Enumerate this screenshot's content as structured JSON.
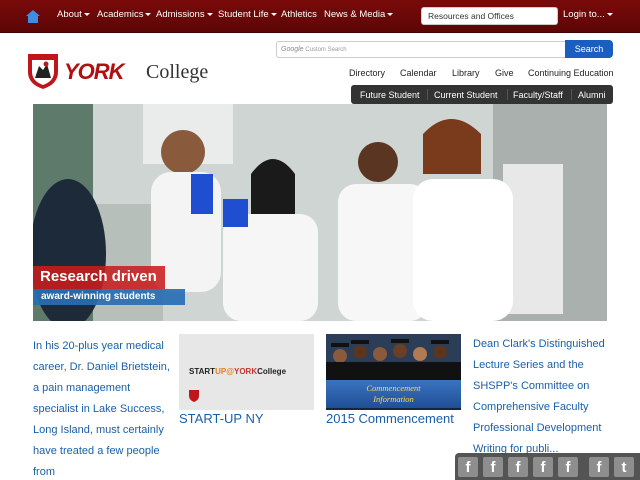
{
  "topnav": {
    "items": [
      {
        "label": "About",
        "has_dropdown": true
      },
      {
        "label": "Academics",
        "has_dropdown": true
      },
      {
        "label": "Admissions",
        "has_dropdown": true
      },
      {
        "label": "Student Life",
        "has_dropdown": true
      },
      {
        "label": "Athletics",
        "has_dropdown": false
      },
      {
        "label": "News & Media",
        "has_dropdown": true
      }
    ],
    "resources_label": "Resources and Offices",
    "login_label": "Login to...",
    "home_icon": "home-icon",
    "bar_color": "#6b0808"
  },
  "search": {
    "placeholder": "Custom Search",
    "provider": "Google",
    "button_label": "Search",
    "button_color": "#1a5fbf"
  },
  "logo": {
    "york": "YORK",
    "college": "College"
  },
  "secondary_links": [
    "Directory",
    "Calendar",
    "Library",
    "Give",
    "Continuing Education"
  ],
  "audience_links": [
    "Future Student",
    "Current Student",
    "Faculty/Staff",
    "Alumni"
  ],
  "hero": {
    "title": "Research driven",
    "subtitle": "award-winning students"
  },
  "story": {
    "text": "In his 20-plus year medical career, Dr. Daniel Brietstein, a pain management specialist in Lake Success, Long Island, must certainly have treated a few people from"
  },
  "cards": [
    {
      "caption": "START-UP NY",
      "image_text_start": "START",
      "image_text_at": "UP@",
      "image_text_york": "YORK",
      "image_text_college": "College"
    },
    {
      "caption": "2015 Commencement",
      "banner_line1": "Commencement",
      "banner_line2": "Information"
    }
  ],
  "right_story": {
    "text": "Dean Clark's Distinguished Lecture Series and the SHSPP's Committee on Comprehensive Faculty Professional Development Writing for publi..."
  },
  "share_icons": [
    "facebook-icon",
    "facebook-icon",
    "facebook-icon",
    "facebook-icon",
    "facebook-icon",
    "facebook-icon",
    "twitter-icon"
  ]
}
